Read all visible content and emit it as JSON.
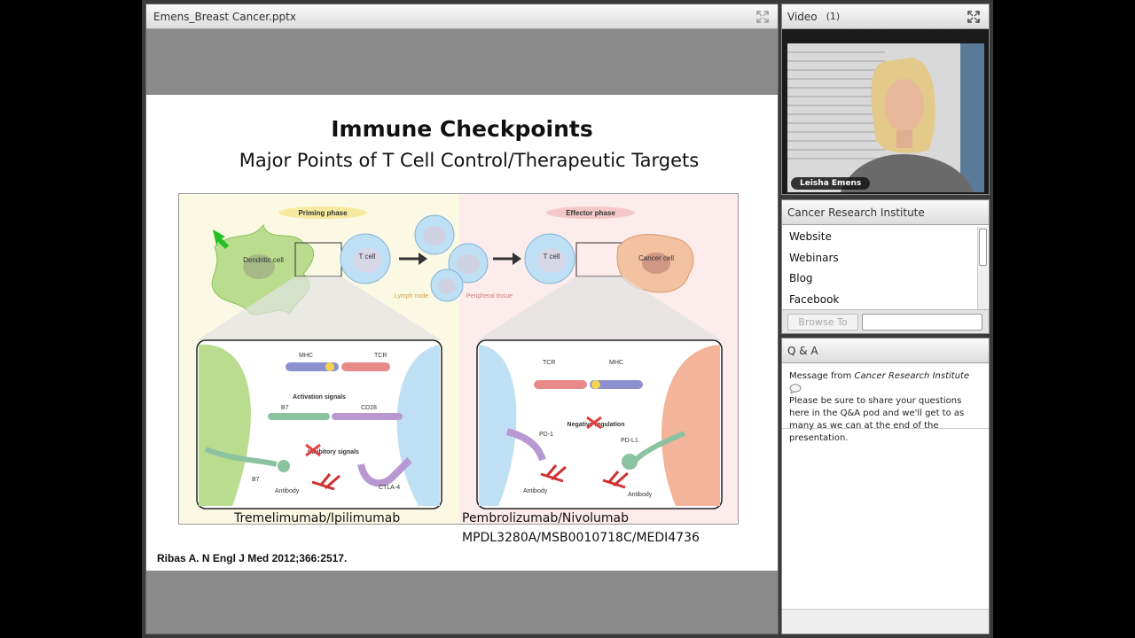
{
  "share_pod": {
    "title": "Emens_Breast Cancer.pptx"
  },
  "slide": {
    "title": "Immune Checkpoints",
    "subtitle": "Major Points of T Cell Control/Therapeutic Targets",
    "figure": {
      "priming_phase": "Priming phase",
      "effector_phase": "Effector phase",
      "dendritic_cell": "Dendritic cell",
      "t_cell": "T cell",
      "t_cell_2": "T cell",
      "cancer_cell": "Cancer cell",
      "lymph_node": "Lymph node",
      "peripheral_tissue": "Peripheral tissue",
      "mhc_left": "MHC",
      "tcr_left": "TCR",
      "activation_signals": "Activation signals",
      "b7_top": "B7",
      "cd28": "CD28",
      "inhibitory_signals": "Inhibitory signals",
      "b7_bottom": "B7",
      "antibody_left": "Antibody",
      "ctla4": "CTLA-4",
      "tcr_right": "TCR",
      "mhc_right": "MHC",
      "negative_regulation": "Negative regulation",
      "pd1": "PD-1",
      "pdl1": "PD-L1",
      "antibody_right_1": "Antibody",
      "antibody_right_2": "Antibody"
    },
    "drug_left": "Tremelimumab/Ipilimumab",
    "drug_right": "Pembrolizumab/Nivolumab",
    "drug_right_2": "MPDL3280A/MSB0010718C/MEDI4736",
    "citation": "Ribas A. N Engl J Med 2012;366:2517."
  },
  "video_pod": {
    "title": "Video",
    "count": "(1)",
    "presenter_name": "Leisha Emens"
  },
  "links_pod": {
    "title": "Cancer Research Institute",
    "links": [
      "Website",
      "Webinars",
      "Blog",
      "Facebook"
    ],
    "browse_button": "Browse To"
  },
  "qa_pod": {
    "title": "Q & A",
    "message_prefix": "Message from",
    "message_sender": "Cancer Research Institute",
    "message_body": "Please be sure to share your questions here in the Q&A pod and we'll get to as many as we can at the end of the presentation."
  }
}
